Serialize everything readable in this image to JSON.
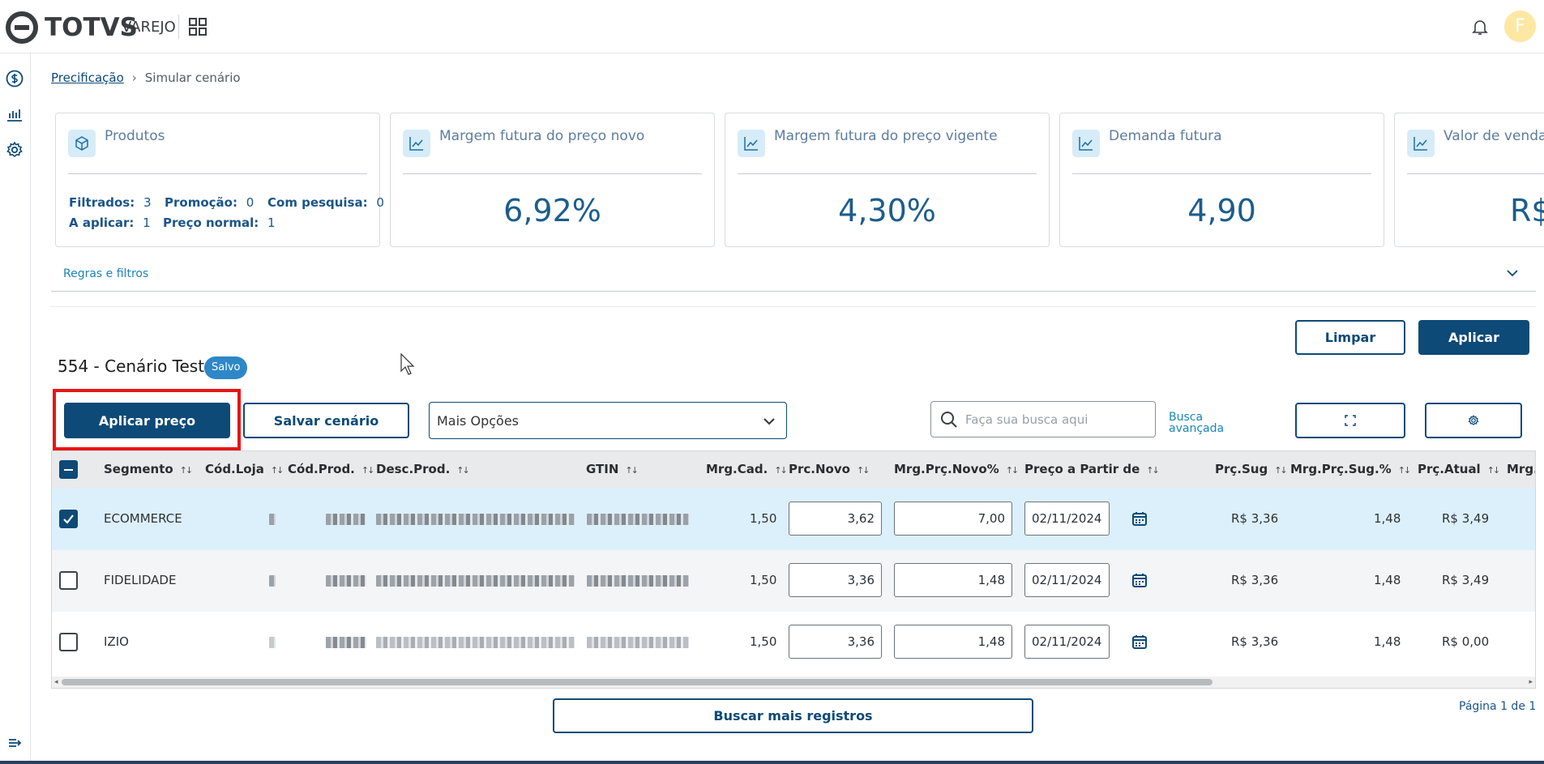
{
  "header": {
    "brand": "TOTVS",
    "brand_sub": "VAREJO",
    "avatar_initial": "F"
  },
  "breadcrumb": {
    "link": "Precificação",
    "current": "Simular cenário"
  },
  "cards": {
    "products": {
      "title": "Produtos",
      "filtered_label": "Filtrados:",
      "filtered_value": "3",
      "promo_label": "Promoção:",
      "promo_value": "0",
      "research_label": "Com pesquisa:",
      "research_value": "0",
      "to_apply_label": "A aplicar:",
      "to_apply_value": "1",
      "normal_label": "Preço normal:",
      "normal_value": "1"
    },
    "margin_new": {
      "title": "Margem futura do preço novo",
      "value": "6,92%"
    },
    "margin_current": {
      "title": "Margem futura do preço vigente",
      "value": "4,30%"
    },
    "demand": {
      "title": "Demanda futura",
      "value": "4,90"
    },
    "sales": {
      "title": "Valor de venda",
      "value": "R$"
    }
  },
  "rules": {
    "label": "Regras e filtros"
  },
  "actions": {
    "clear": "Limpar",
    "apply": "Aplicar",
    "apply_price": "Aplicar preço",
    "save_scenario": "Salvar cenário",
    "more_options": "Mais Opções",
    "search_placeholder": "Faça sua busca aqui",
    "advanced_line1": "Busca",
    "advanced_line2": "avançada",
    "load_more": "Buscar mais registros"
  },
  "scenario": {
    "title": "554 - Cenário Teste",
    "badge": "Salvo"
  },
  "table": {
    "columns": {
      "segment": "Segmento",
      "store": "Cód.Loja",
      "product": "Cód.Prod.",
      "desc": "Desc.Prod.",
      "gtin": "GTIN",
      "mrg_cad": "Mrg.Cad.",
      "prc_new": "Prc.Novo",
      "mrg_new": "Mrg.Prç.Novo%",
      "price_from": "Preço a Partir de",
      "prc_sug": "Prç.Sug",
      "mrg_sug": "Mrg.Prç.Sug.%",
      "prc_cur": "Prç.Atual",
      "mrg_cut": "Mrg.I"
    },
    "rows": [
      {
        "segment": "ECOMMERCE",
        "mrg_cad": "1,50",
        "prc_new": "3,62",
        "mrg_new": "7,00",
        "date": "02/11/2024",
        "prc_sug": "R$ 3,36",
        "mrg_sug": "1,48",
        "prc_cur": "R$ 3,49"
      },
      {
        "segment": "FIDELIDADE",
        "mrg_cad": "1,50",
        "prc_new": "3,36",
        "mrg_new": "1,48",
        "date": "02/11/2024",
        "prc_sug": "R$ 3,36",
        "mrg_sug": "1,48",
        "prc_cur": "R$ 3,49"
      },
      {
        "segment": "IZIO",
        "mrg_cad": "1,50",
        "prc_new": "3,36",
        "mrg_new": "1,48",
        "date": "02/11/2024",
        "prc_sug": "R$ 3,36",
        "mrg_sug": "1,48",
        "prc_cur": "R$ 0,00"
      }
    ]
  },
  "pagination": {
    "label": "Página 1 de 1"
  },
  "colors": {
    "primary": "#0d4a77",
    "selected_row": "#dcf0fc",
    "alt_row": "#f4f5f6",
    "highlight": "#e81515"
  }
}
